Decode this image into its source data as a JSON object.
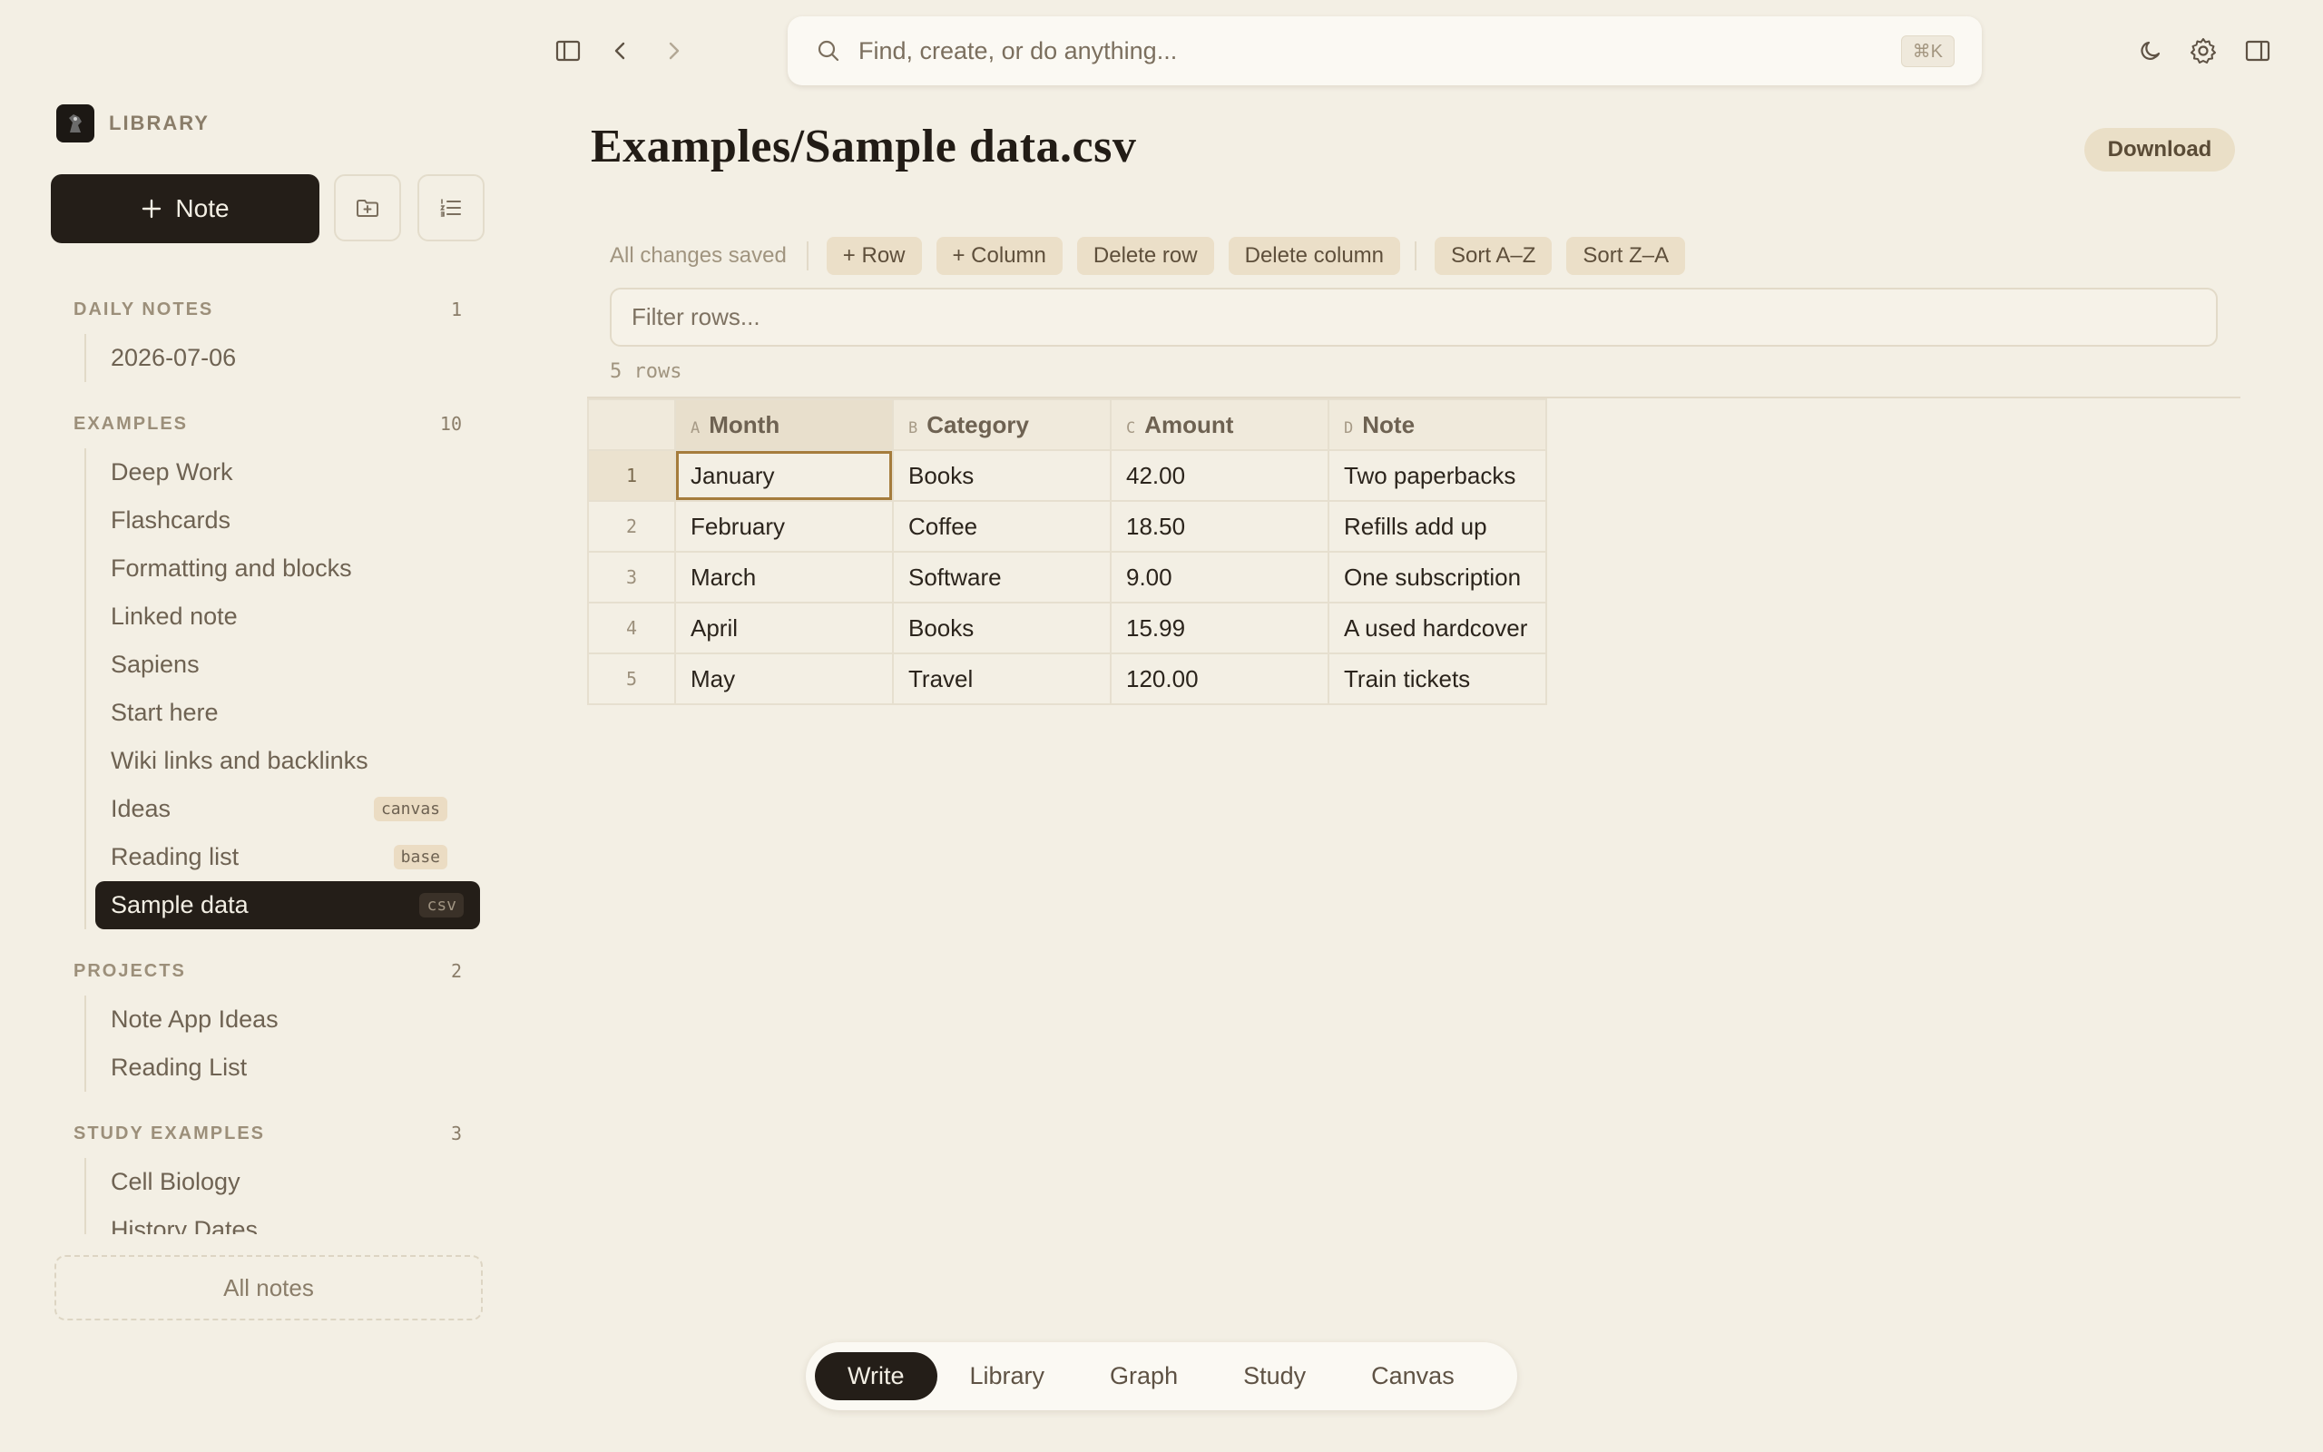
{
  "sidebar": {
    "library_title": "LIBRARY",
    "note_button_label": "Note",
    "sections": [
      {
        "title": "DAILY NOTES",
        "count": "1",
        "items": [
          {
            "label": "2026-07-06",
            "tag": ""
          }
        ]
      },
      {
        "title": "EXAMPLES",
        "count": "10",
        "items": [
          {
            "label": "Deep Work",
            "tag": ""
          },
          {
            "label": "Flashcards",
            "tag": ""
          },
          {
            "label": "Formatting and blocks",
            "tag": ""
          },
          {
            "label": "Linked note",
            "tag": ""
          },
          {
            "label": "Sapiens",
            "tag": ""
          },
          {
            "label": "Start here",
            "tag": ""
          },
          {
            "label": "Wiki links and backlinks",
            "tag": ""
          },
          {
            "label": "Ideas",
            "tag": "canvas"
          },
          {
            "label": "Reading list",
            "tag": "base"
          },
          {
            "label": "Sample data",
            "tag": "csv"
          }
        ]
      },
      {
        "title": "PROJECTS",
        "count": "2",
        "items": [
          {
            "label": "Note App Ideas",
            "tag": ""
          },
          {
            "label": "Reading List",
            "tag": ""
          }
        ]
      },
      {
        "title": "STUDY EXAMPLES",
        "count": "3",
        "items": [
          {
            "label": "Cell Biology",
            "tag": ""
          },
          {
            "label": "History Dates",
            "tag": ""
          }
        ]
      }
    ],
    "all_notes_label": "All notes"
  },
  "search": {
    "placeholder": "Find, create, or do anything...",
    "shortcut": "⌘K"
  },
  "main": {
    "title": "Examples/Sample data.csv",
    "download_label": "Download",
    "save_status": "All changes saved",
    "toolbar": {
      "add_row": "+ Row",
      "add_column": "+ Column",
      "delete_row": "Delete row",
      "delete_column": "Delete column",
      "sort_az": "Sort A–Z",
      "sort_za": "Sort Z–A"
    },
    "filter_placeholder": "Filter rows...",
    "row_count": "5 rows",
    "table": {
      "columns": [
        {
          "letter": "A",
          "name": "Month"
        },
        {
          "letter": "B",
          "name": "Category"
        },
        {
          "letter": "C",
          "name": "Amount"
        },
        {
          "letter": "D",
          "name": "Note"
        }
      ],
      "rows": [
        {
          "num": "1",
          "cells": [
            "January",
            "Books",
            "42.00",
            "Two paperbacks"
          ]
        },
        {
          "num": "2",
          "cells": [
            "February",
            "Coffee",
            "18.50",
            "Refills add up"
          ]
        },
        {
          "num": "3",
          "cells": [
            "March",
            "Software",
            "9.00",
            "One subscription"
          ]
        },
        {
          "num": "4",
          "cells": [
            "April",
            "Books",
            "15.99",
            "A used hardcover"
          ]
        },
        {
          "num": "5",
          "cells": [
            "May",
            "Travel",
            "120.00",
            "Train tickets"
          ]
        }
      ]
    }
  },
  "bottom_nav": {
    "items": [
      "Write",
      "Library",
      "Graph",
      "Study",
      "Canvas"
    ],
    "active": "Write"
  }
}
